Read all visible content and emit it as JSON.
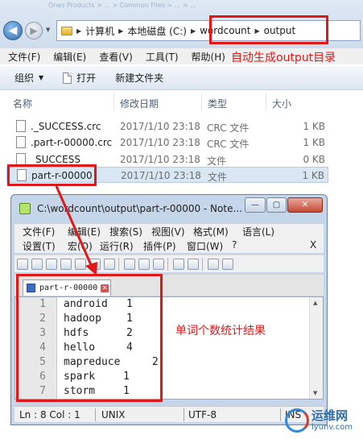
{
  "explorer": {
    "faded_header": "Ones Products > ... > Common Files > ... > ...",
    "breadcrumb": [
      "计算机",
      "本地磁盘 (C:)",
      "wordcount",
      "output"
    ],
    "menu": [
      "文件(F)",
      "编辑(E)",
      "查看(V)",
      "工具(T)",
      "帮助(H)"
    ],
    "annotation_top": "自动生成output目录",
    "toolbar": {
      "organize": "组织",
      "open": "打开",
      "new_folder": "新建文件夹"
    },
    "columns": {
      "name": "名称",
      "date": "修改日期",
      "type": "类型",
      "size": "大小"
    },
    "files": [
      {
        "name": "._SUCCESS.crc",
        "date": "2017/1/10 23:18",
        "type": "CRC 文件",
        "size": "1 KB"
      },
      {
        "name": ".part-r-00000.crc",
        "date": "2017/1/10 23:18",
        "type": "CRC 文件",
        "size": "1 KB"
      },
      {
        "name": "_SUCCESS",
        "date": "2017/1/10 23:18",
        "type": "文件",
        "size": "0 KB"
      },
      {
        "name": "part-r-00000",
        "date": "2017/1/10 23:18",
        "type": "文件",
        "size": "1 KB"
      }
    ]
  },
  "notepad": {
    "title": "C:\\wordcount\\output\\part-r-00000 - Note...",
    "menu_row1": [
      "文件(F)",
      "编辑(E)",
      "搜索(S)",
      "视图(V)",
      "格式(M)",
      "语言(L)"
    ],
    "menu_row2": [
      "设置(T)",
      "宏(O)",
      "运行(R)",
      "插件(P)",
      "窗口(W)",
      "?"
    ],
    "menu_close": "X",
    "tab_label": "part-r-00000",
    "lines": [
      {
        "n": "1",
        "word": "android",
        "count": "1"
      },
      {
        "n": "2",
        "word": "hadoop",
        "count": "1"
      },
      {
        "n": "3",
        "word": "hdfs",
        "count": "2"
      },
      {
        "n": "4",
        "word": "hello",
        "count": "4"
      },
      {
        "n": "5",
        "word": "mapreduce",
        "count": "2"
      },
      {
        "n": "6",
        "word": "spark",
        "count": "1"
      },
      {
        "n": "7",
        "word": "storm",
        "count": "1"
      }
    ],
    "annotation_result": "单词个数统计结果",
    "status": {
      "position": "Ln : 8    Col : 1",
      "eol": "UNIX",
      "encoding": "UTF-8",
      "mode": "INS"
    }
  },
  "watermark": {
    "name": "运维网",
    "url": "iyunv.com"
  },
  "colors": {
    "highlight": "#e01818",
    "selection": "#d9e6f4"
  }
}
